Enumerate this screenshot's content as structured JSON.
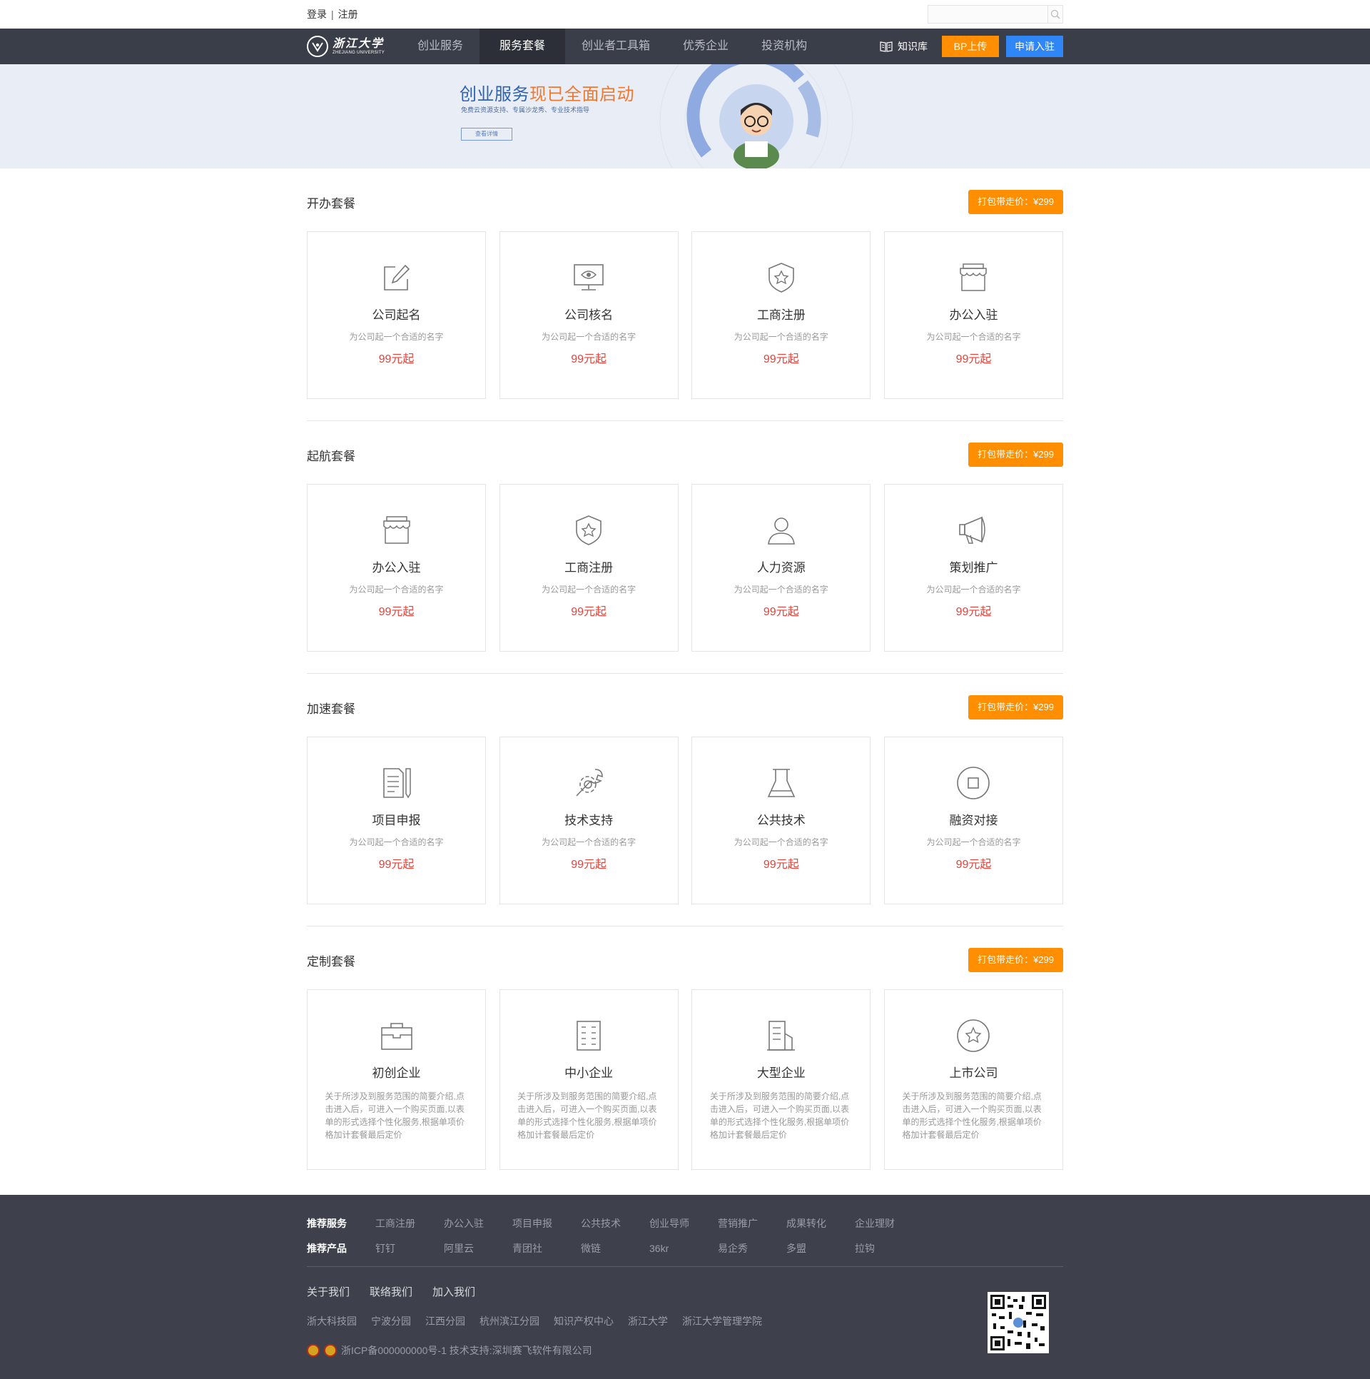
{
  "topbar": {
    "login": "登录",
    "separator": "|",
    "register": "注册",
    "search_placeholder": ""
  },
  "nav": {
    "items": [
      "创业服务",
      "服务套餐",
      "创业者工具箱",
      "优秀企业",
      "投资机构"
    ],
    "knowledge": "知识库",
    "bp_upload": "BP上传",
    "apply": "申请入驻"
  },
  "banner": {
    "title_part1": "创业服务",
    "title_part2": "现已全面启动",
    "subtitle": "免费云资源支持、专属沙龙秀、专业技术指导",
    "button": "查看详情"
  },
  "sections": [
    {
      "title": "开办套餐",
      "pack": "打包带走价：¥299",
      "cards": [
        {
          "icon": "pencil-icon",
          "title": "公司起名",
          "desc": "为公司起一个合适的名字",
          "price": "99元起"
        },
        {
          "icon": "monitor-eye-icon",
          "title": "公司核名",
          "desc": "为公司起一个合适的名字",
          "price": "99元起"
        },
        {
          "icon": "shield-star-icon",
          "title": "工商注册",
          "desc": "为公司起一个合适的名字",
          "price": "99元起"
        },
        {
          "icon": "store-icon",
          "title": "办公入驻",
          "desc": "为公司起一个合适的名字",
          "price": "99元起"
        }
      ]
    },
    {
      "title": "起航套餐",
      "pack": "打包带走价：¥299",
      "cards": [
        {
          "icon": "store-icon",
          "title": "办公入驻",
          "desc": "为公司起一个合适的名字",
          "price": "99元起"
        },
        {
          "icon": "shield-star-icon",
          "title": "工商注册",
          "desc": "为公司起一个合适的名字",
          "price": "99元起"
        },
        {
          "icon": "person-icon",
          "title": "人力资源",
          "desc": "为公司起一个合适的名字",
          "price": "99元起"
        },
        {
          "icon": "megaphone-icon",
          "title": "策划推广",
          "desc": "为公司起一个合适的名字",
          "price": "99元起"
        }
      ]
    },
    {
      "title": "加速套餐",
      "pack": "打包带走价：¥299",
      "cards": [
        {
          "icon": "document-icon",
          "title": "项目申报",
          "desc": "为公司起一个合适的名字",
          "price": "99元起"
        },
        {
          "icon": "wrench-gear-icon",
          "title": "技术支持",
          "desc": "为公司起一个合适的名字",
          "price": "99元起"
        },
        {
          "icon": "flask-icon",
          "title": "公共技术",
          "desc": "为公司起一个合适的名字",
          "price": "99元起"
        },
        {
          "icon": "circle-square-icon",
          "title": "融资对接",
          "desc": "为公司起一个合适的名字",
          "price": "99元起"
        }
      ]
    }
  ],
  "custom": {
    "title": "定制套餐",
    "pack": "打包带走价：¥299",
    "cards": [
      {
        "icon": "briefcase-icon",
        "title": "初创企业",
        "desc": "关于所涉及到服务范围的简要介绍,点击进入后，可进入一个购买页面,以表单的形式选择个性化服务,根据单项价格加计套餐最后定价"
      },
      {
        "icon": "building-icon",
        "title": "中小企业",
        "desc": "关于所涉及到服务范围的简要介绍,点击进入后，可进入一个购买页面,以表单的形式选择个性化服务,根据单项价格加计套餐最后定价"
      },
      {
        "icon": "office-icon",
        "title": "大型企业",
        "desc": "关于所涉及到服务范围的简要介绍,点击进入后，可进入一个购买页面,以表单的形式选择个性化服务,根据单项价格加计套餐最后定价"
      },
      {
        "icon": "circle-star-icon",
        "title": "上市公司",
        "desc": "关于所涉及到服务范围的简要介绍,点击进入后，可进入一个购买页面,以表单的形式选择个性化服务,根据单项价格加计套餐最后定价"
      }
    ]
  },
  "footer": {
    "services_label": "推荐服务",
    "services": [
      "工商注册",
      "办公入驻",
      "项目申报",
      "公共技术",
      "创业导师",
      "营销推广",
      "成果转化",
      "企业理财"
    ],
    "products_label": "推荐产品",
    "products": [
      "钉钉",
      "阿里云",
      "青团社",
      "微链",
      "36kr",
      "易企秀",
      "多盟",
      "拉钩"
    ],
    "links": [
      "关于我们",
      "联络我们",
      "加入我们"
    ],
    "parks": [
      "浙大科技园",
      "宁波分园",
      "江西分园",
      "杭州滨江分园",
      "知识产权中心",
      "浙江大学",
      "浙江大学管理学院"
    ],
    "copyright": "浙ICP备000000000号-1  技术支持:深圳赛飞软件有限公司"
  },
  "colors": {
    "nav_bg": "#3a3e48",
    "orange": "#ff8f00",
    "blue": "#2f86f6",
    "price_red": "#e8433a",
    "footer_bg": "#3e414b"
  }
}
